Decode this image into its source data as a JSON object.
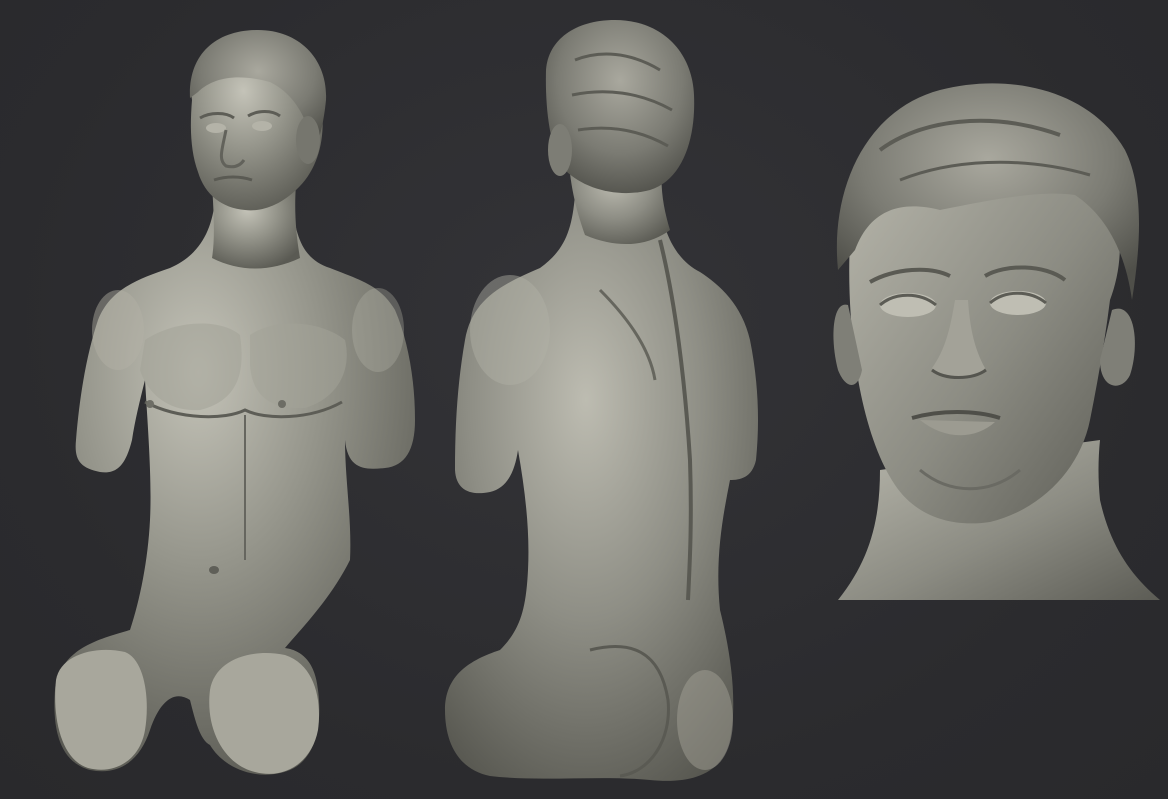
{
  "scene": {
    "background_color": "#2e2e31",
    "material_color": "#8f8f86",
    "material_shadow": "#55554f",
    "material_highlight": "#c9c8bd"
  },
  "views": [
    {
      "name": "front-torso-view",
      "icon": "sculpt-front-view"
    },
    {
      "name": "back-torso-view",
      "icon": "sculpt-back-view"
    },
    {
      "name": "head-closeup-view",
      "icon": "sculpt-head-view"
    }
  ]
}
